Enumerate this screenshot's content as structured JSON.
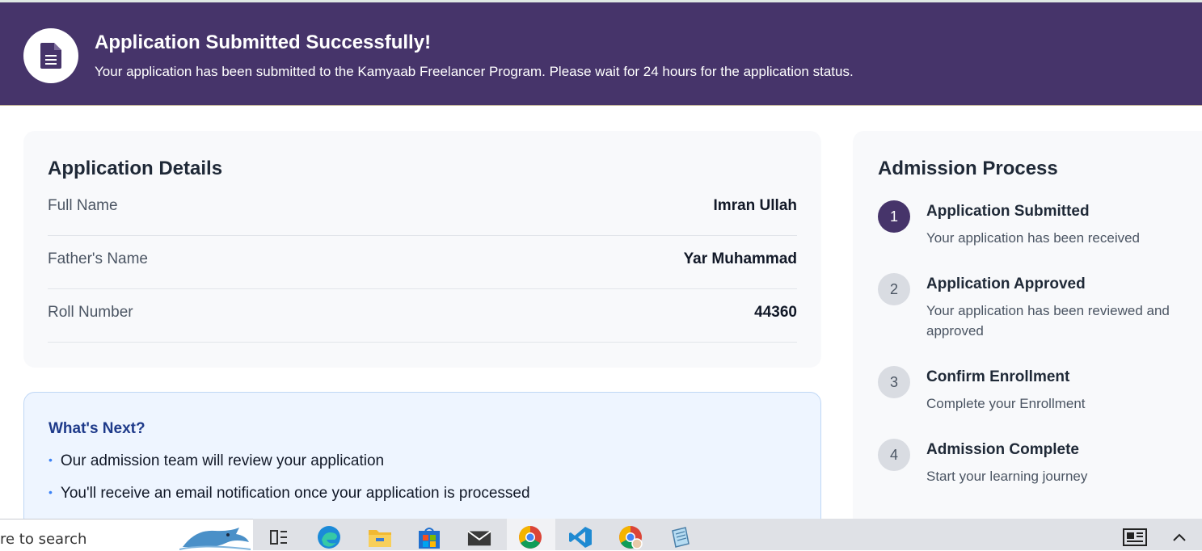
{
  "banner": {
    "title": "Application Submitted Successfully!",
    "subtitle": "Your application has been submitted to the Kamyaab Freelancer Program. Please wait for 24 hours for the application status.",
    "icon": "document-icon",
    "color": "#46346a"
  },
  "details": {
    "title": "Application Details",
    "rows": [
      {
        "label": "Full Name",
        "value": "Imran Ullah"
      },
      {
        "label": "Father's Name",
        "value": "Yar Muhammad"
      },
      {
        "label": "Roll Number",
        "value": "44360"
      }
    ]
  },
  "next": {
    "title": "What's Next?",
    "items": [
      "Our admission team will review your application",
      "You'll receive an email notification once your application is processed"
    ]
  },
  "process": {
    "title": "Admission Process",
    "steps": [
      {
        "num": "1",
        "title": "Application Submitted",
        "desc": "Your application has been received",
        "status": "active"
      },
      {
        "num": "2",
        "title": "Application Approved",
        "desc": "Your application has been reviewed and approved",
        "status": "pending"
      },
      {
        "num": "3",
        "title": "Confirm Enrollment",
        "desc": "Complete your Enrollment",
        "status": "pending"
      },
      {
        "num": "4",
        "title": "Admission Complete",
        "desc": "Start your learning journey",
        "status": "pending"
      }
    ]
  },
  "taskbar": {
    "search_text": "re to search",
    "icons": [
      "dolphin-icon",
      "task-view-icon",
      "edge-icon",
      "file-explorer-icon",
      "store-icon",
      "mail-icon",
      "chrome-icon",
      "vscode-icon",
      "chrome-profile-icon",
      "notepad-icon",
      "news-icon",
      "chevron-up-icon"
    ]
  }
}
